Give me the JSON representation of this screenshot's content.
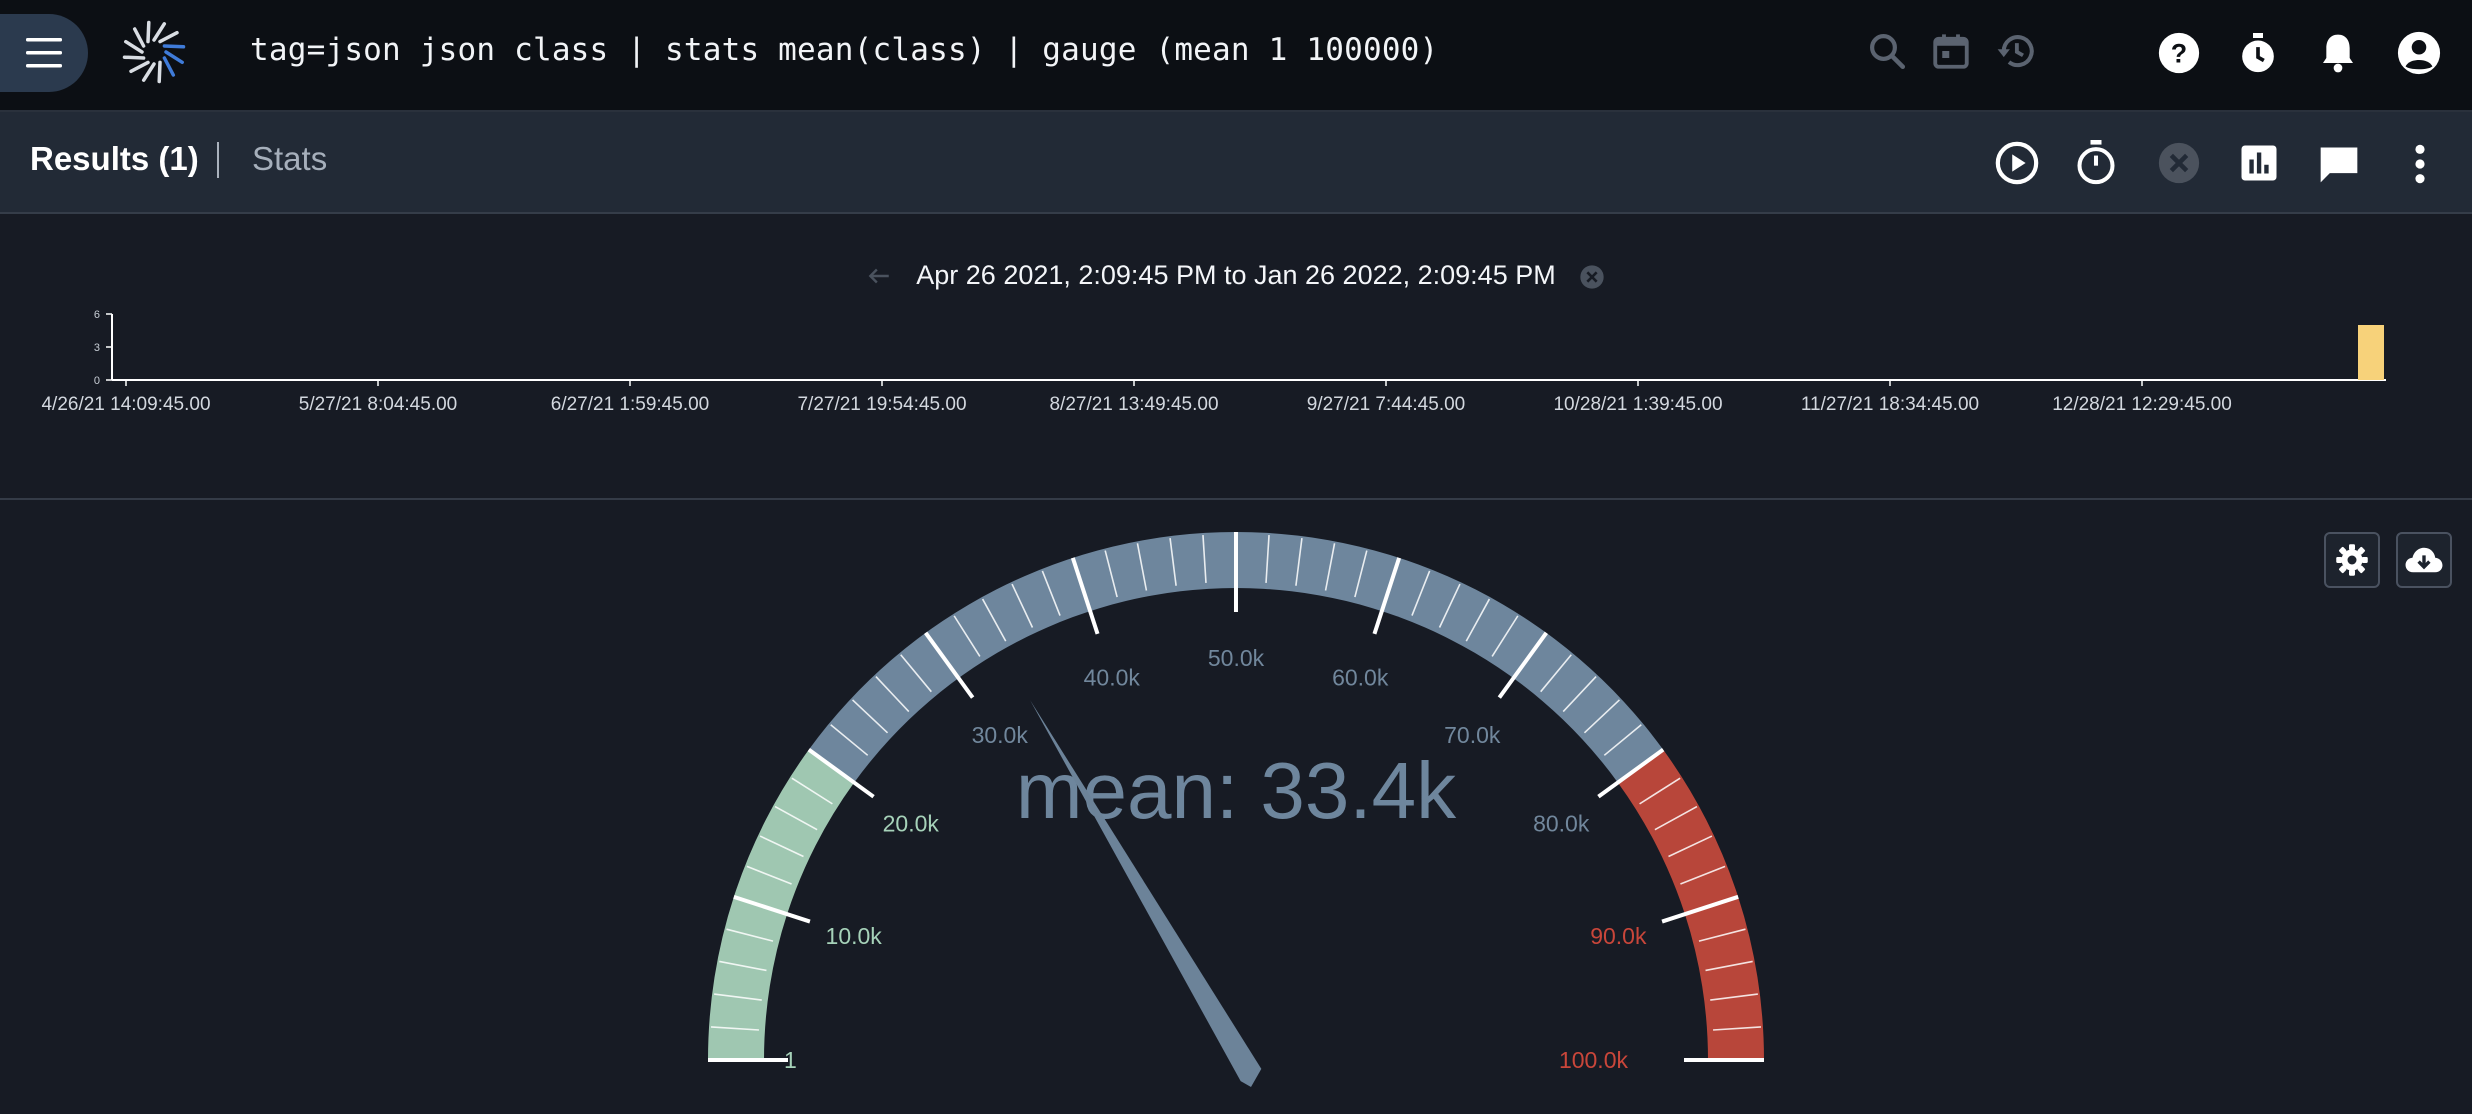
{
  "topbar": {
    "query": "tag=json json class | stats mean(class) | gauge (mean 1 100000)",
    "icons": [
      "menu-icon",
      "logo-icon",
      "search-icon",
      "calendar-icon",
      "history-icon",
      "help-icon",
      "timer-icon",
      "bell-icon",
      "account-icon"
    ]
  },
  "results_bar": {
    "results_tab": "Results (1)",
    "stats_tab": "Stats",
    "icons": [
      "play-icon",
      "stopwatch-icon",
      "cancel-icon",
      "chart-icon",
      "comment-icon",
      "more-vert-icon"
    ]
  },
  "timeline": {
    "range_label": "Apr 26 2021, 2:09:45 PM to Jan 26 2022, 2:09:45 PM",
    "y_ticks": [
      "6",
      "3",
      "0"
    ],
    "x_ticks": [
      "4/26/21 14:09:45.00",
      "5/27/21 8:04:45.00",
      "6/27/21 1:59:45.00",
      "7/27/21 19:54:45.00",
      "8/27/21 13:49:45.00",
      "9/27/21 7:44:45.00",
      "10/28/21 1:39:45.00",
      "11/27/21 18:34:45.00",
      "12/28/21 12:29:45.00"
    ],
    "bar_value": 5,
    "bar_color": "#f7d27a"
  },
  "gauge": {
    "title": "mean: 33.4k",
    "min": 1,
    "max": 100000,
    "value": 33400,
    "ticks": [
      {
        "label": "1",
        "value": 1
      },
      {
        "label": "10.0k",
        "value": 10000
      },
      {
        "label": "20.0k",
        "value": 20000
      },
      {
        "label": "30.0k",
        "value": 30000
      },
      {
        "label": "40.0k",
        "value": 40000
      },
      {
        "label": "50.0k",
        "value": 50000
      },
      {
        "label": "60.0k",
        "value": 60000
      },
      {
        "label": "70.0k",
        "value": 70000
      },
      {
        "label": "80.0k",
        "value": 80000
      },
      {
        "label": "90.0k",
        "value": 90000
      },
      {
        "label": "100.0k",
        "value": 100000
      }
    ],
    "bands": [
      {
        "from": 1,
        "to": 20000,
        "color": "#9fc7b1"
      },
      {
        "from": 20000,
        "to": 80000,
        "color": "#6e869d"
      },
      {
        "from": 80000,
        "to": 100000,
        "color": "#b8463a"
      }
    ],
    "label_colors": {
      "low": "#a6d2b9",
      "mid": "#71879c",
      "high": "#c9463a"
    },
    "needle_color": "#6c8399",
    "tools": [
      "settings-icon",
      "download-icon"
    ]
  }
}
